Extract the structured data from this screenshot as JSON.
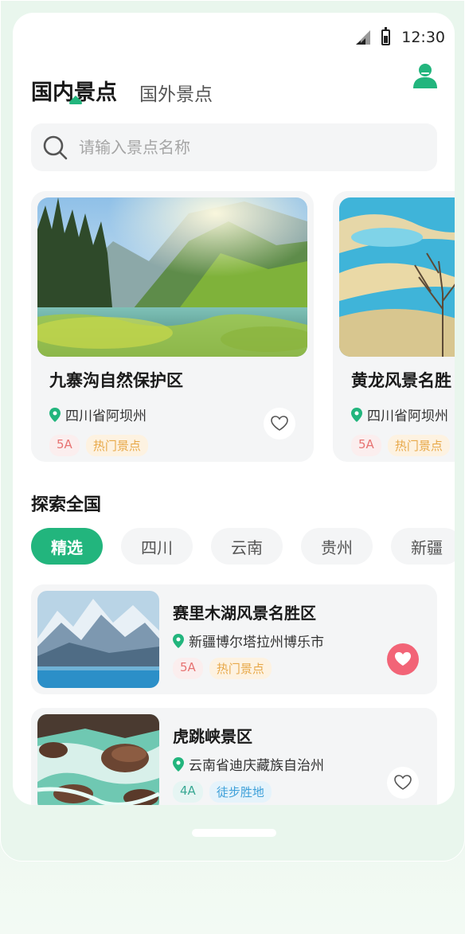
{
  "status": {
    "time": "12:30",
    "signal_icon": "signal-icon",
    "battery_icon": "battery-icon"
  },
  "header": {
    "tabs": [
      {
        "label": "国内景点",
        "active": true
      },
      {
        "label": "国外景点",
        "active": false
      }
    ],
    "user_icon": "user-icon"
  },
  "search": {
    "placeholder": "请输入景点名称",
    "icon": "search-icon"
  },
  "featured": [
    {
      "title": "九寨沟自然保护区",
      "location": "四川省阿坝州",
      "tags": [
        "5A",
        "热门景点"
      ],
      "favorited": false
    },
    {
      "title": "黄龙风景名胜",
      "location": "四川省阿坝州",
      "tags": [
        "5A",
        "热门景点"
      ],
      "favorited": false
    }
  ],
  "explore": {
    "title": "探索全国",
    "chips": [
      "精选",
      "四川",
      "云南",
      "贵州",
      "新疆"
    ],
    "selected_chip": "精选"
  },
  "list": [
    {
      "title": "赛里木湖风景名胜区",
      "location": "新疆博尔塔拉州博乐市",
      "tags": [
        "5A",
        "热门景点"
      ],
      "favorited": true
    },
    {
      "title": "虎跳峡景区",
      "location": "云南省迪庆藏族自治州",
      "tags": [
        "4A",
        "徒步胜地"
      ],
      "favorited": false
    }
  ],
  "colors": {
    "accent": "#22b57d",
    "favorite": "#f26477"
  }
}
